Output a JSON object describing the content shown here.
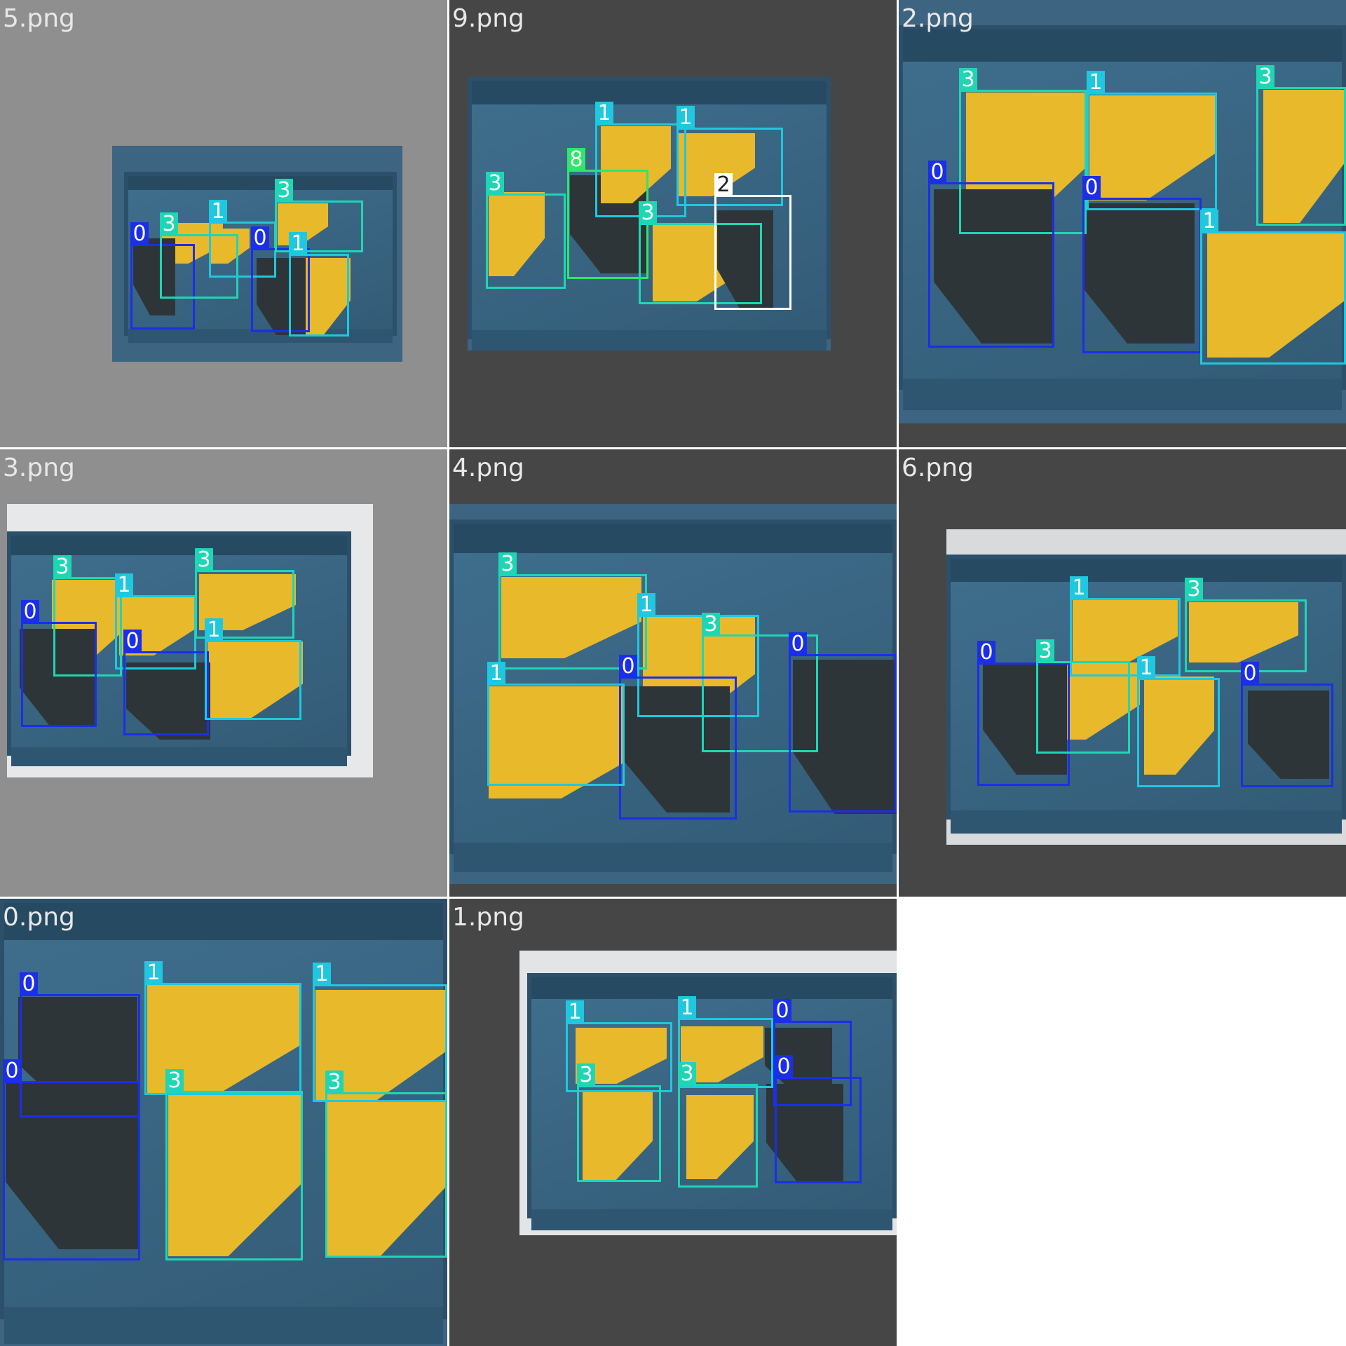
{
  "class_colors": {
    "0": "#1b2ee8",
    "1": "#1fc8de",
    "2": "#ffffff",
    "3": "#1fd6b4",
    "8": "#2ee66a"
  },
  "label_text_colors": {
    "2": "#222222"
  },
  "tiles": [
    {
      "name": "5.png",
      "bg": "#8f8f8f",
      "boxes": [
        {
          "cls": "0",
          "label": "0"
        },
        {
          "cls": "3",
          "label": "3"
        },
        {
          "cls": "1",
          "label": "1"
        },
        {
          "cls": "0",
          "label": "0"
        },
        {
          "cls": "3",
          "label": "3"
        },
        {
          "cls": "1",
          "label": "1"
        }
      ]
    },
    {
      "name": "9.png",
      "bg": "#464646",
      "boxes": [
        {
          "cls": "3",
          "label": "3"
        },
        {
          "cls": "8",
          "label": "8"
        },
        {
          "cls": "1",
          "label": "1"
        },
        {
          "cls": "1",
          "label": "1"
        },
        {
          "cls": "3",
          "label": "3"
        },
        {
          "cls": "2",
          "label": "2"
        }
      ]
    },
    {
      "name": "2.png",
      "bg": "#464646",
      "boxes": [
        {
          "cls": "3",
          "label": "3"
        },
        {
          "cls": "1",
          "label": "1"
        },
        {
          "cls": "3",
          "label": "3"
        },
        {
          "cls": "0",
          "label": "0"
        },
        {
          "cls": "0",
          "label": "0"
        },
        {
          "cls": "1",
          "label": "1"
        }
      ]
    },
    {
      "name": "3.png",
      "bg": "#8f8f8f",
      "boxes": [
        {
          "cls": "3",
          "label": "3"
        },
        {
          "cls": "1",
          "label": "1"
        },
        {
          "cls": "3",
          "label": "3"
        },
        {
          "cls": "0",
          "label": "0"
        },
        {
          "cls": "0",
          "label": "0"
        },
        {
          "cls": "1",
          "label": "1"
        }
      ]
    },
    {
      "name": "4.png",
      "bg": "#464646",
      "boxes": [
        {
          "cls": "3",
          "label": "3"
        },
        {
          "cls": "1",
          "label": "1"
        },
        {
          "cls": "3",
          "label": "3"
        },
        {
          "cls": "0",
          "label": "0"
        },
        {
          "cls": "1",
          "label": "1"
        },
        {
          "cls": "0",
          "label": "0"
        }
      ]
    },
    {
      "name": "6.png",
      "bg": "#464646",
      "boxes": [
        {
          "cls": "1",
          "label": "1"
        },
        {
          "cls": "3",
          "label": "3"
        },
        {
          "cls": "0",
          "label": "0"
        },
        {
          "cls": "3",
          "label": "3"
        },
        {
          "cls": "1",
          "label": "1"
        },
        {
          "cls": "0",
          "label": "0"
        }
      ]
    },
    {
      "name": "0.png",
      "bg": "#464646",
      "boxes": [
        {
          "cls": "0",
          "label": "0"
        },
        {
          "cls": "1",
          "label": "1"
        },
        {
          "cls": "1",
          "label": "1"
        },
        {
          "cls": "0",
          "label": "0"
        },
        {
          "cls": "3",
          "label": "3"
        },
        {
          "cls": "3",
          "label": "3"
        }
      ]
    },
    {
      "name": "1.png",
      "bg": "#464646",
      "boxes": [
        {
          "cls": "1",
          "label": "1"
        },
        {
          "cls": "1",
          "label": "1"
        },
        {
          "cls": "0",
          "label": "0"
        },
        {
          "cls": "3",
          "label": "3"
        },
        {
          "cls": "3",
          "label": "3"
        },
        {
          "cls": "0",
          "label": "0"
        }
      ]
    }
  ]
}
